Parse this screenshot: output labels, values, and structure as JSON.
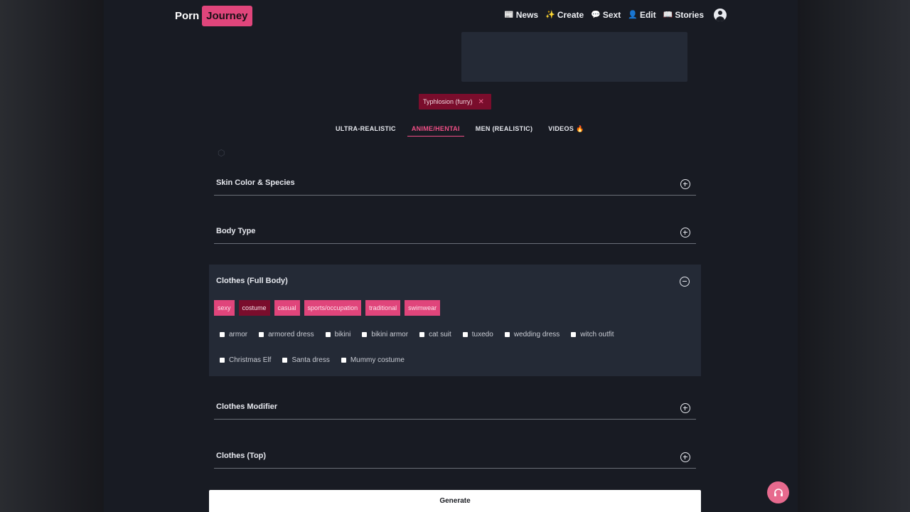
{
  "brand": {
    "part1": "Porn",
    "part2": "Journey"
  },
  "nav": [
    {
      "icon": "📰",
      "label": "News"
    },
    {
      "icon": "✨",
      "label": "Create"
    },
    {
      "icon": "💬",
      "label": "Sext"
    },
    {
      "icon": "👤",
      "label": "Edit"
    },
    {
      "icon": "📖",
      "label": "Stories"
    }
  ],
  "selected_chip": {
    "label": "Typhlosion (furry)",
    "remove": "✕"
  },
  "tabs": [
    {
      "label": "ULTRA-REALISTIC"
    },
    {
      "label": "ANIME/HENTAI"
    },
    {
      "label": "MEN (REALISTIC)"
    },
    {
      "label": "VIDEOS",
      "badge": "🔥"
    }
  ],
  "sections": {
    "skin": "Skin Color & Species",
    "body": "Body Type",
    "clothes_full": "Clothes (Full Body)",
    "clothes_modifier": "Clothes Modifier",
    "clothes_top": "Clothes (Top)"
  },
  "categories": [
    "sexy",
    "costume",
    "casual",
    "sports/occupation",
    "traditional",
    "swimwear"
  ],
  "options_row1": [
    "armor",
    "armored dress",
    "bikini",
    "bikini armor",
    "cat suit",
    "tuxedo",
    "wedding dress",
    "witch outfit"
  ],
  "options_row2": [
    "Christmas Elf",
    "Santa dress",
    "Mummy costume"
  ],
  "generate_label": "Generate"
}
